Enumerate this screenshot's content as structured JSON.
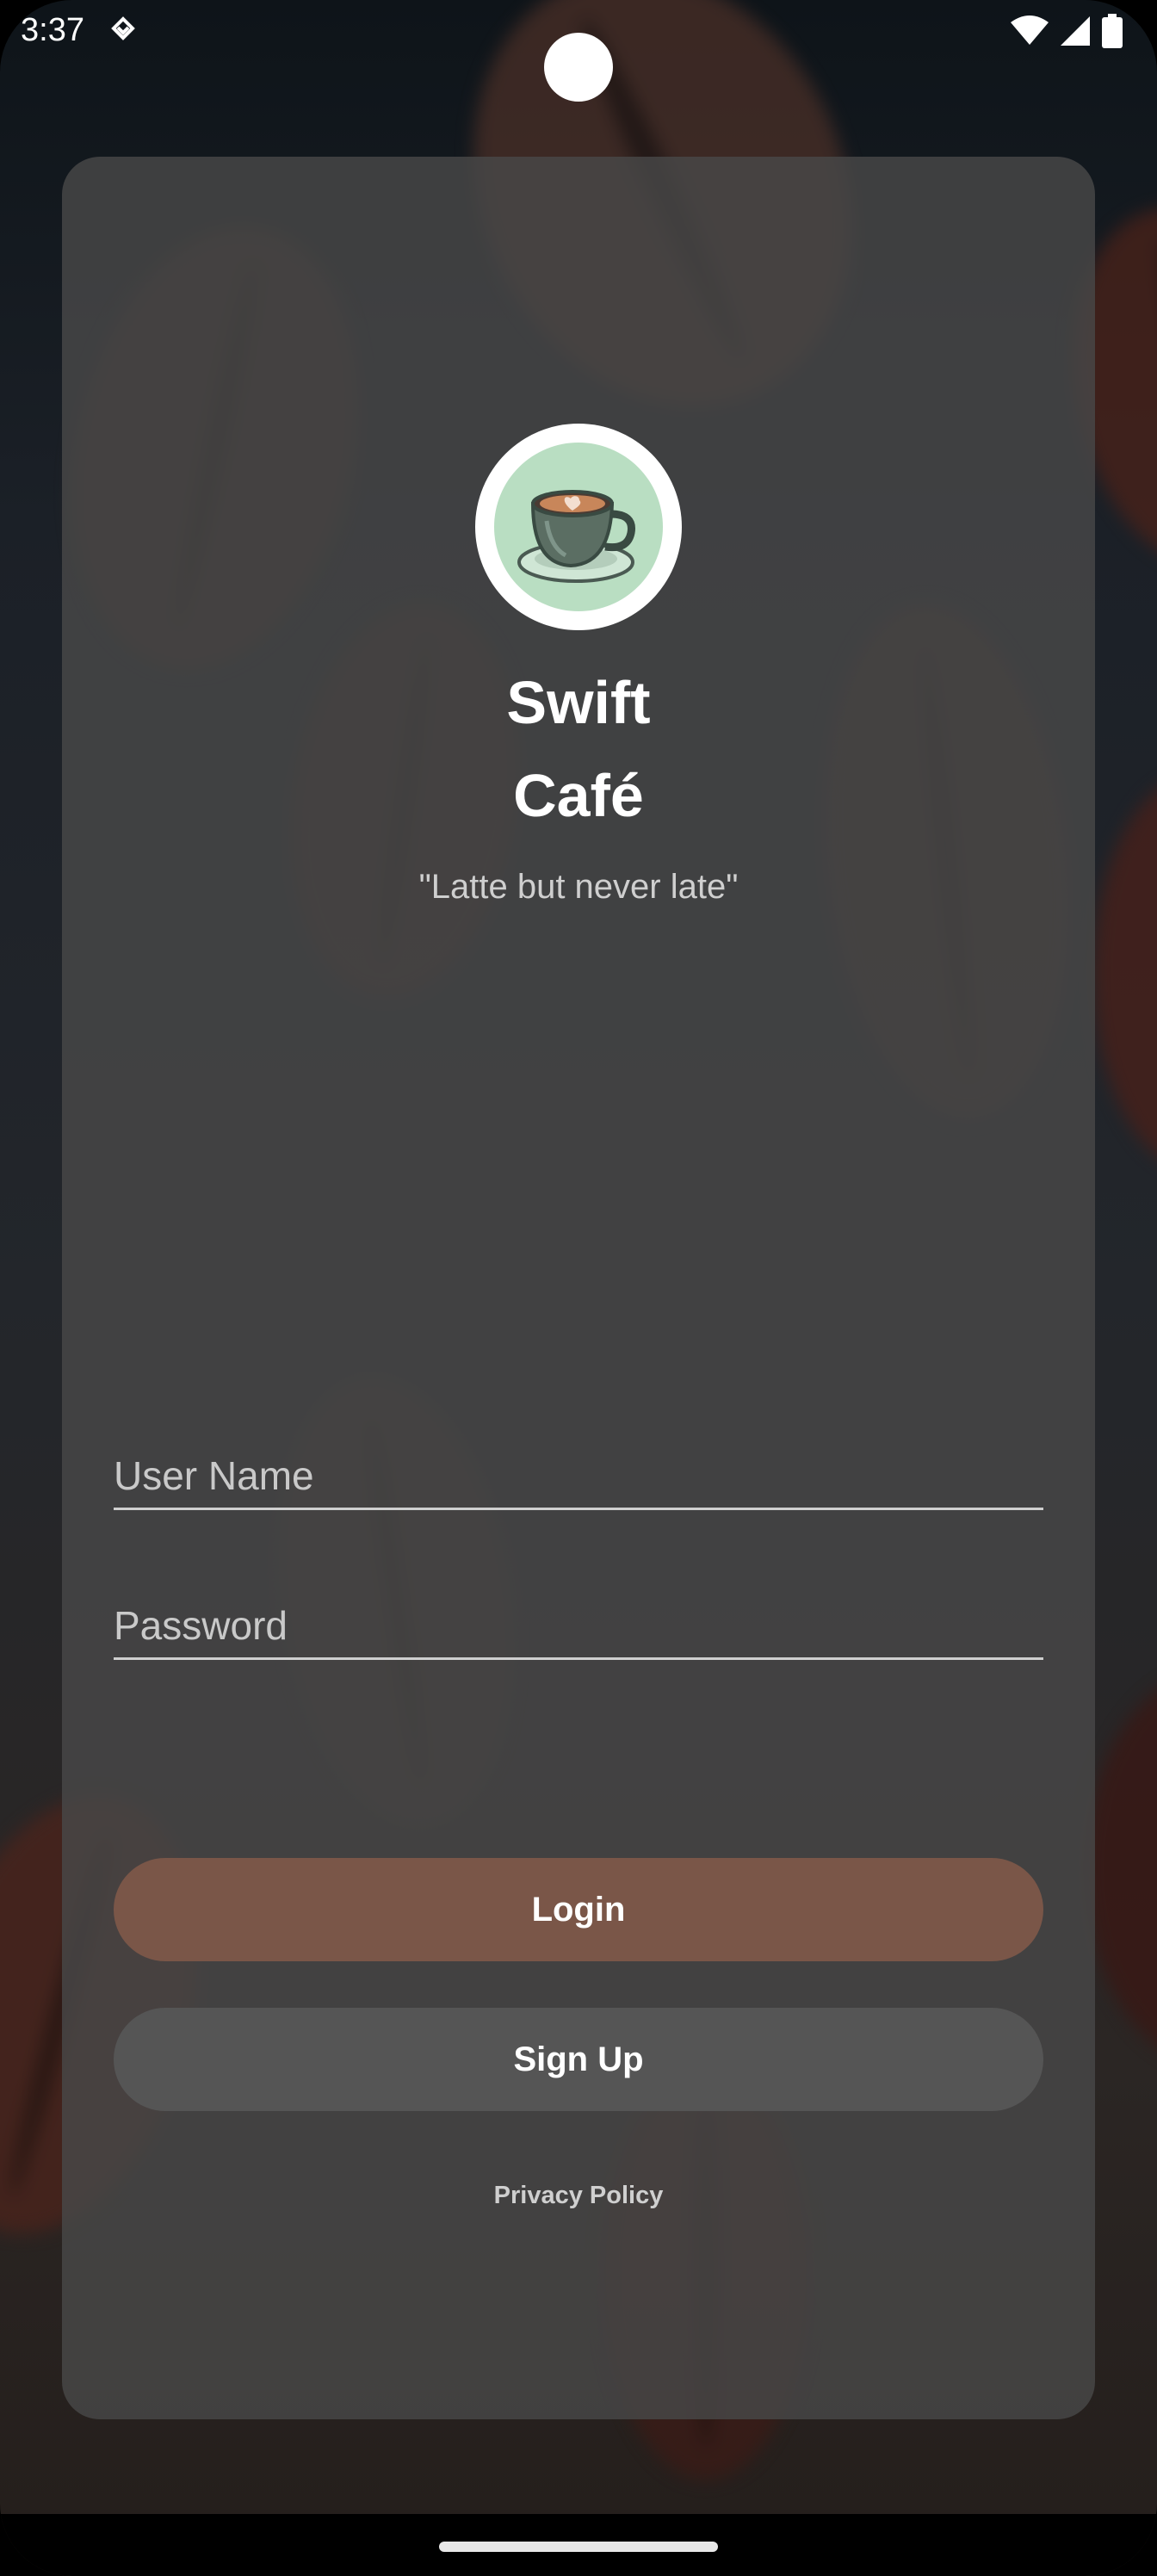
{
  "status_bar": {
    "time": "3:37",
    "notification_icon": "notification-diamond-icon",
    "wifi_icon": "wifi-icon",
    "signal_icon": "cellular-signal-icon",
    "battery_icon": "battery-icon"
  },
  "app": {
    "logo_icon": "coffee-cup-icon",
    "title_line1": "Swift",
    "title_line2": "Café",
    "tagline": "\"Latte but never late\""
  },
  "form": {
    "username_placeholder": "User Name",
    "username_value": "",
    "password_placeholder": "Password",
    "password_value": ""
  },
  "buttons": {
    "login_label": "Login",
    "signup_label": "Sign Up"
  },
  "footer": {
    "privacy_label": "Privacy Policy"
  },
  "colors": {
    "login_button": "#7a5648",
    "signup_button": "#555555",
    "card_background": "#484848",
    "logo_background": "#b9dec2"
  }
}
